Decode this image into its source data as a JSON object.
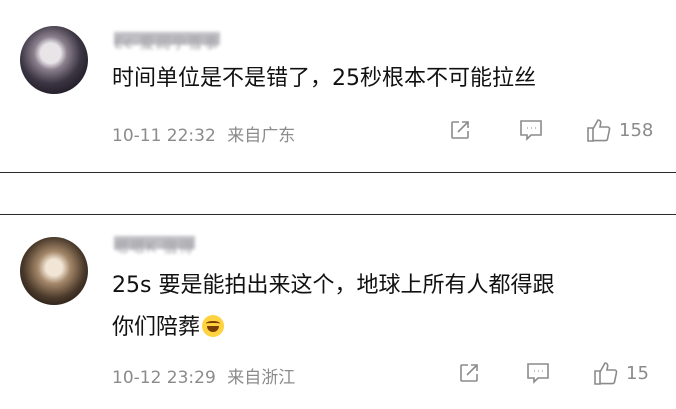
{
  "comments": [
    {
      "username": "Ec 爱润宁雪事",
      "text": "时间单位是不是错了，25秒根本不可能拉丝",
      "date": "10-11 22:32",
      "location": "来自广东",
      "likes": "158",
      "icons": {
        "share": "share-icon",
        "comment": "comment-icon",
        "like": "thumbs-up-icon"
      }
    },
    {
      "username": "嗯嗯K 宿得",
      "text_line1": "25s 要是能拍出来这个，地球上所有人都得跟",
      "text_line2": "你们陪葬",
      "text_emoji": "laughing-tears-emoji",
      "date": "10-12 23:29",
      "location": "来自浙江",
      "likes": "15",
      "icons": {
        "share": "share-icon",
        "comment": "comment-icon",
        "like": "thumbs-up-icon"
      }
    }
  ],
  "colors": {
    "text": "#111111",
    "meta": "#8b8b8b",
    "divider": "#2a2a2a",
    "background": "#ffffff"
  }
}
